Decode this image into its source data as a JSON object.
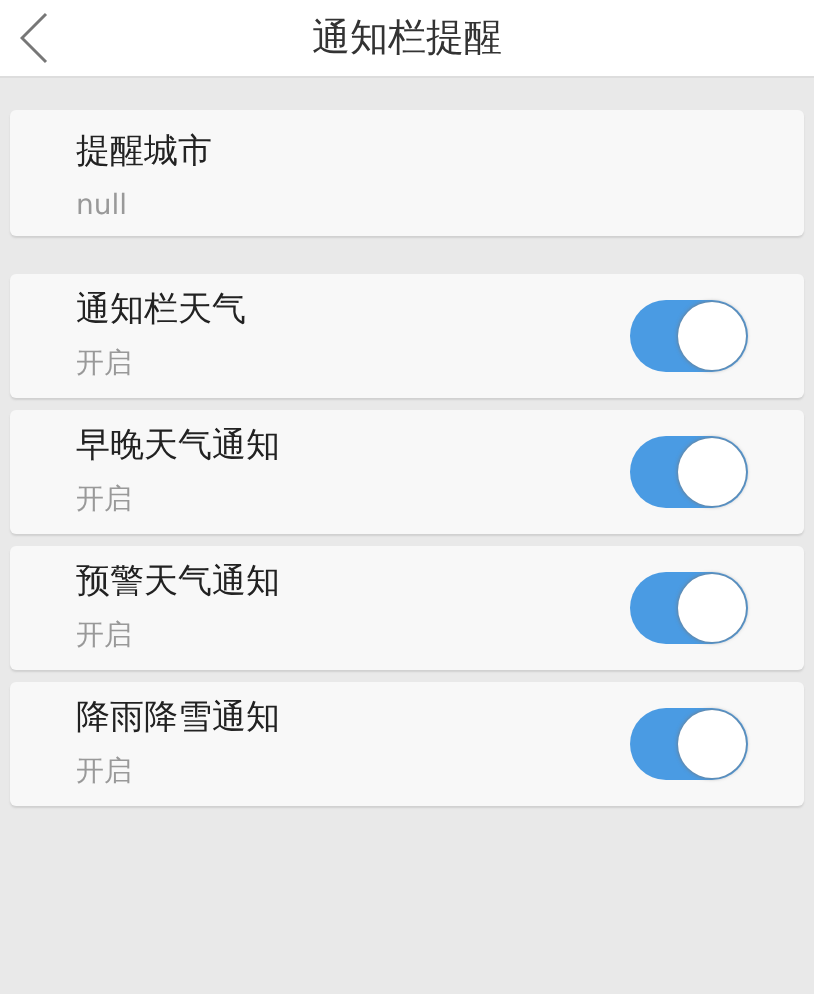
{
  "header": {
    "title": "通知栏提醒"
  },
  "city": {
    "label": "提醒城市",
    "value": "null"
  },
  "settings": [
    {
      "label": "通知栏天气",
      "status": "开启",
      "on": true
    },
    {
      "label": "早晚天气通知",
      "status": "开启",
      "on": true
    },
    {
      "label": "预警天气通知",
      "status": "开启",
      "on": true
    },
    {
      "label": "降雨降雪通知",
      "status": "开启",
      "on": true
    }
  ]
}
